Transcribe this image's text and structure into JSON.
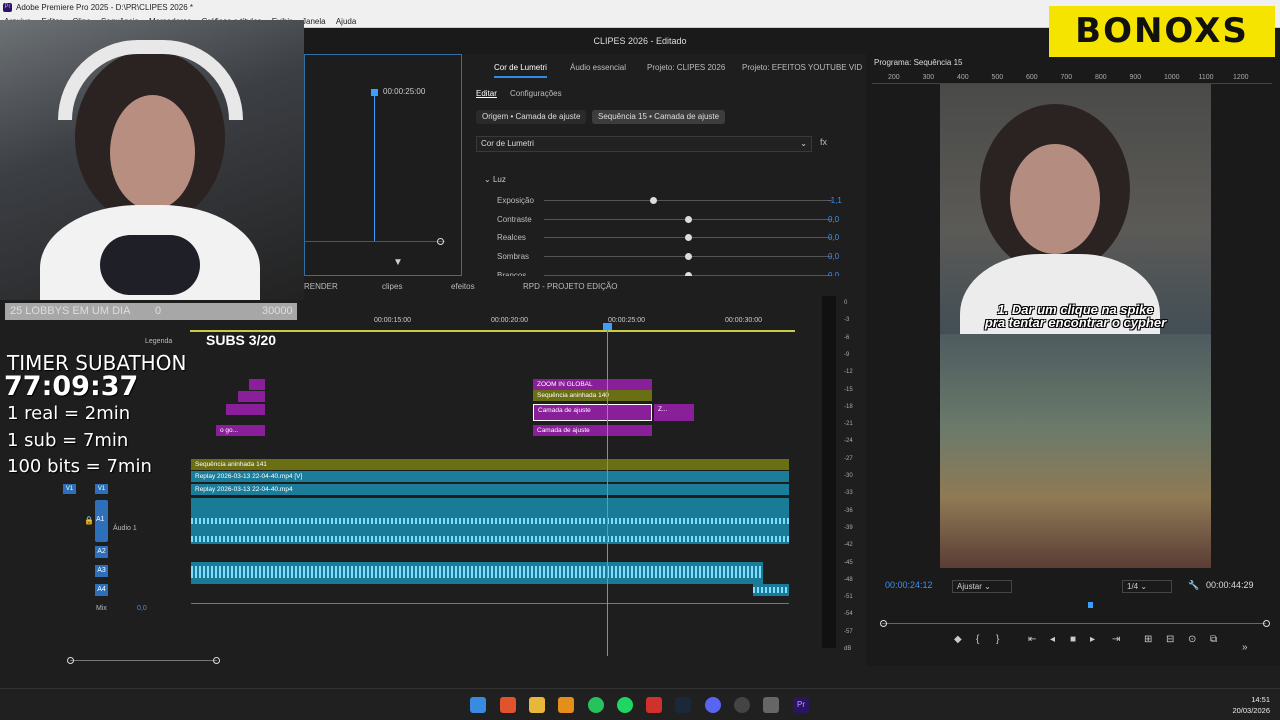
{
  "titlebar": {
    "title": "Adobe Premiere Pro 2025 - D:\\PR\\CLIPES 2026 *"
  },
  "menu": [
    "Arquivo",
    "Editar",
    "Clipe",
    "Sequência",
    "Marcadores",
    "Gráficos e títulos",
    "Exibir",
    "Janela",
    "Ajuda"
  ],
  "document": {
    "title": "CLIPES 2026 - Editado"
  },
  "logo": {
    "text": "BONOXS"
  },
  "effect_controls": {
    "timecode": "00:00:25:00"
  },
  "lumetri": {
    "tabs": [
      "Cor de Lumetri",
      "Áudio essencial",
      "Projeto: CLIPES 2026",
      "Projeto: EFEITOS YOUTUBE VID"
    ],
    "subtabs": [
      "Editar",
      "Configurações"
    ],
    "source_pill": "Origem • Camada de ajuste",
    "seq_pill": "Sequência 15 • Camada de ajuste",
    "effect_select": "Cor de Lumetri",
    "section": "Luz",
    "rows": [
      {
        "label": "Exposição",
        "value": "-1,1",
        "pos": 0.38
      },
      {
        "label": "Contraste",
        "value": "0,0",
        "pos": 0.5
      },
      {
        "label": "Realces",
        "value": "0,0",
        "pos": 0.5
      },
      {
        "label": "Sombras",
        "value": "0,0",
        "pos": 0.5
      },
      {
        "label": "Brancos",
        "value": "0,0",
        "pos": 0.5
      }
    ]
  },
  "program": {
    "title": "Programa: Sequência 15",
    "subtitle_line1": "1. Dar um clique na spike",
    "subtitle_line2": "pra tentar encontrar o cypher",
    "timecode": "00:00:24:12",
    "fit": "Ajustar",
    "quality": "1/4",
    "duration": "00:00:44:29",
    "ruler": [
      "200",
      "300",
      "400",
      "500",
      "600",
      "700",
      "800",
      "900",
      "1000",
      "1100",
      "1200"
    ]
  },
  "timeline": {
    "seq_tabs": [
      "RENDER",
      "clipes",
      "efeitos",
      "RPD - PROJETO EDIÇÃO"
    ],
    "ruler": [
      "00:00:15:00",
      "00:00:20:00",
      "00:00:25:00",
      "00:00:30:00"
    ],
    "caption_track": "Legenda",
    "caption_text": "SUBS 3/20",
    "clips": {
      "zoom": "ZOOM IN GLOBAL",
      "nested140": "Sequência aninhada 140",
      "adjust1": "Camada de ajuste",
      "adjust2": "Camada de ajuste",
      "small1": "o go...",
      "small2": "Z...",
      "nested141": "Sequência aninhada 141",
      "replay_v": "Replay 2026-03-13 22-04-40.mp4 [V]",
      "replay": "Replay 2026-03-13 22-04-40.mp4"
    },
    "tracks": {
      "v1": "V1",
      "a1": "A1",
      "a2": "A2",
      "a3": "A3",
      "a4": "A4",
      "audio1": "Áudio 1",
      "mix": "Mix",
      "mix_val": "0,0"
    },
    "meter_scale": [
      "0",
      "-3",
      "-6",
      "-9",
      "-12",
      "-15",
      "-18",
      "-21",
      "-24",
      "-27",
      "-30",
      "-33",
      "-36",
      "-39",
      "-42",
      "-45",
      "-48",
      "-51",
      "-54",
      "-57",
      "dB"
    ]
  },
  "overlay": {
    "lobby_label": "25 LOBBYS EM UM DIA",
    "lobby_value": "0",
    "lobby_max": "30000",
    "timer_title": "TIMER SUBATHON",
    "timer": "77:09:37",
    "rule1": "1 real = 2min",
    "rule2": "1 sub = 7min",
    "rule3": "100 bits = 7min"
  },
  "taskbar": {
    "time": "14:51",
    "date": "20/03/2026"
  }
}
